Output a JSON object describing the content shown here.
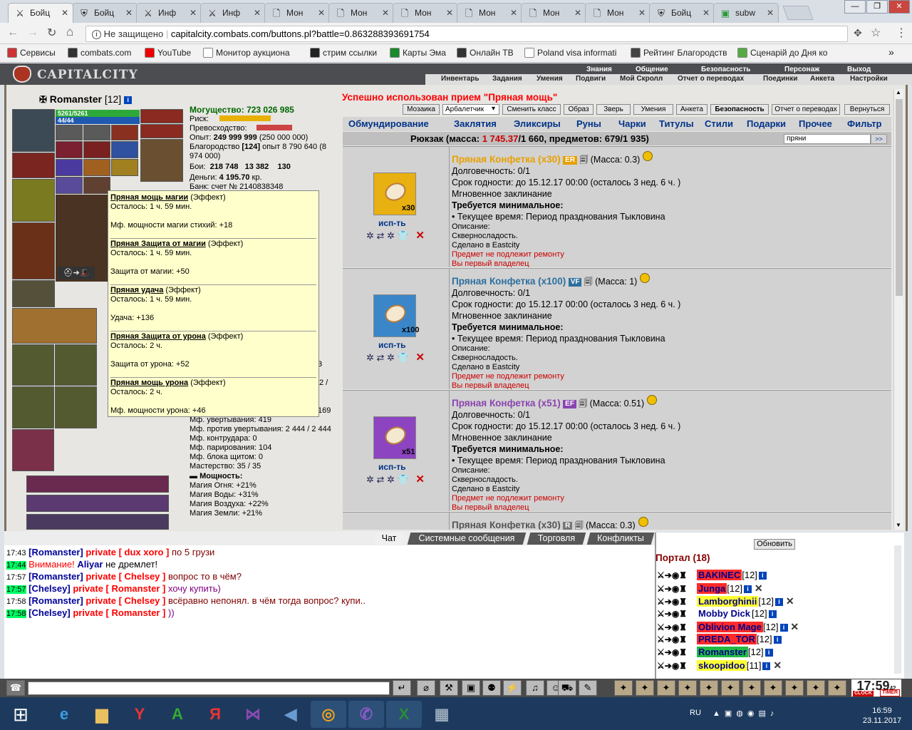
{
  "tabs": [
    {
      "label": "Бойц",
      "icon": "crossed-swords-icon",
      "active": true
    },
    {
      "label": "Бойц",
      "icon": "shield-icon",
      "active": false
    },
    {
      "label": "Инф",
      "icon": "crossed-swords-icon",
      "active": false
    },
    {
      "label": "Инф",
      "icon": "crossed-swords-icon",
      "active": false
    },
    {
      "label": "Мон",
      "icon": "page-icon",
      "active": false
    },
    {
      "label": "Мон",
      "icon": "page-icon",
      "active": false
    },
    {
      "label": "Мон",
      "icon": "page-icon",
      "active": false
    },
    {
      "label": "Мон",
      "icon": "page-icon",
      "active": false
    },
    {
      "label": "Мон",
      "icon": "page-icon",
      "active": false
    },
    {
      "label": "Мон",
      "icon": "page-icon",
      "active": false
    },
    {
      "label": "Бойц",
      "icon": "shield-icon",
      "active": false
    },
    {
      "label": "subw",
      "icon": "green-square-icon",
      "active": false
    }
  ],
  "address": {
    "security": "Не защищено",
    "url": "capitalcity.combats.com/buttons.pl?battle=0.863288393691754"
  },
  "bookmarks": [
    "Сервисы",
    "combats.com",
    "YouTube",
    "Монитор аукциона",
    "стрим ссылки",
    "Карты Эма",
    "Онлайн ТВ",
    "Poland visa informati",
    "Рейтинг Благородств",
    "Сценарій до Дня ко"
  ],
  "header": {
    "logo": "CAPITALCITY",
    "menu1": [
      "Знания",
      "Общение",
      "Безопасность",
      "Персонаж",
      "Выход"
    ],
    "menu2": [
      "Инвентарь",
      "Задания",
      "Умения",
      "Подвиги",
      "Мой Скролл",
      "Отчет о переводах",
      "Поединки",
      "Анкета",
      "Настройки"
    ]
  },
  "character": {
    "name": "Romanster",
    "level": "[12]",
    "hp": "5261/5261",
    "mana": "44/44"
  },
  "stats": {
    "power_label": "Могущество:",
    "power_value": "723 026 985",
    "risk_label": "Риск:",
    "superiority_label": "Превосходство:",
    "exp_label": "Опыт:",
    "exp_value": "249 999 999",
    "exp_extra": "(250 000 000)",
    "nobility_label": "Благородство",
    "nobility_value": "[124]",
    "nobility_exp": "опыт 8 790 640 (8 974 000)",
    "fights_label": "Бои:",
    "fights_win": "218 748",
    "fights_lose": "13 382",
    "fights_draw": "130",
    "money_label": "Деньги:",
    "money_value": "4 195.70",
    "money_unit": "кр.",
    "bank_label": "Банк: счет №",
    "bank_value": "2140838348"
  },
  "lower_stats": {
    "dodge": "Мф. увертывания: 419",
    "antidodge": "Мф. против увертывания: 2 444 / 2 444",
    "counter": "Мф. контрудара: 0",
    "parry": "Мф. парирования: 104",
    "block": "Мф. блока щитом: 0",
    "mastery": "Мастерство: 35 / 35",
    "power_header": "Мощность:",
    "fire": "Магия Огня: +21%",
    "water": "Магия Воды: +31%",
    "air": "Магия Воздуха: +22%",
    "earth": "Магия Земли: +21%",
    "partial1": "3",
    "partial2": "2 /",
    "partial3": "169"
  },
  "tooltip": [
    {
      "name": "Пряная мощь магии",
      "kind": "(Эффект)",
      "left": "Осталось: 1 ч. 59 мин.",
      "bonus": "Мф. мощности магии стихий: +18"
    },
    {
      "name": "Пряная Защита от магии",
      "kind": "(Эффект)",
      "left": "Осталось: 1 ч. 59 мин.",
      "bonus": "Защита от магии: +50"
    },
    {
      "name": "Пряная удача",
      "kind": "(Эффект)",
      "left": "Осталось: 1 ч. 59 мин.",
      "bonus": "Удача: +136"
    },
    {
      "name": "Пряная Защита от урона",
      "kind": "(Эффект)",
      "left": "Осталось: 2 ч.",
      "bonus": "Защита от урона: +52"
    },
    {
      "name": "Пряная мощь урона",
      "kind": "(Эффект)",
      "left": "Осталось: 2 ч.",
      "bonus": "Мф. мощности урона: +46"
    }
  ],
  "success_message": "Успешно использован прием \"Пряная мощь\"",
  "sub_buttons": [
    "Мозаика",
    "Арбалетчик",
    "Сменить класс",
    "Образ",
    "Зверь",
    "Умения",
    "Анкета",
    "Безопасность",
    "Отчет о переводах",
    "Вернуться"
  ],
  "inv_tabs": [
    "Обмундирование",
    "Заклятия",
    "Эликсиры",
    "Руны",
    "Чарки",
    "Титулы",
    "Стили",
    "Подарки",
    "Прочее",
    "Фильтр"
  ],
  "backpack": {
    "prefix": "Рюкзак (масса: ",
    "mass": "1 745.37",
    "suffix": "/1 660, предметов: 679/1 935)"
  },
  "search": {
    "value": "пряни",
    "go": ">>"
  },
  "items": [
    {
      "name": "Пряная Конфетка (x30)",
      "tag": "ER",
      "mass": "(Масса: 0.3)",
      "count": "x30",
      "color": "#e8a000",
      "tagcolor": "#e8a000",
      "bg": "#e8b010"
    },
    {
      "name": "Пряная Конфетка (x100)",
      "tag": "VF",
      "mass": "(Масса: 1)",
      "count": "x100",
      "color": "#2d6f9e",
      "tagcolor": "#2d6f9e",
      "bg": "#3a86c8"
    },
    {
      "name": "Пряная Конфетка (x51)",
      "tag": "EF",
      "mass": "(Масса: 0.51)",
      "count": "x51",
      "color": "#8a44b0",
      "tagcolor": "#8a44b0",
      "bg": "#8d44c0"
    },
    {
      "name": "Пряная Конфетка (x30)",
      "tag": "R",
      "mass": "(Масса: 0.3)",
      "count": "",
      "color": "#555555",
      "tagcolor": "#777777",
      "bg": "#999999"
    }
  ],
  "item_common": {
    "durability": "Долговечность: 0/1",
    "expiry": "Срок годности: до 15.12.17 00:00 (осталось 3 нед. 6 ч. )",
    "type": "Мгновенное заклинание",
    "req": "Требуется минимальное:",
    "req_item": "• Текущее время: Период празднования Тыкловина",
    "desc": "Описание:",
    "desc_text": "Скверносладость.",
    "made": "Сделано в Eastcity",
    "norepair": "Предмет не подлежит ремонту",
    "owner": "Вы первый владелец",
    "use": "исп-ть"
  },
  "chat_tabs": [
    "Чат",
    "Системные сообщения",
    "Торговля",
    "Конфликты"
  ],
  "chat": [
    {
      "time": "17:43",
      "green": false,
      "name": "[Romanster]",
      "priv": "private [ dux xoro ]",
      "text": "по 5 грузи"
    },
    {
      "time": "17:44",
      "green": true,
      "name": "",
      "priv": "",
      "warn": "Внимание!",
      "name2": "Aliyar",
      "text": "не дремлет!"
    },
    {
      "time": "17:57",
      "green": false,
      "name": "[Romanster]",
      "priv": "private [ Chelsey ]",
      "text": "вопрос то в чём?"
    },
    {
      "time": "17:57",
      "green": true,
      "name": "[Chelsey]",
      "priv": "private [ Romanster ]",
      "text": "хочу купить)"
    },
    {
      "time": "17:58",
      "green": false,
      "name": "[Romanster]",
      "priv": "private [ Chelsey ]",
      "text": "всёравно непонял. в чём тогда вопрос? купи.."
    },
    {
      "time": "17:58",
      "green": true,
      "name": "[Chelsey]",
      "priv": "private [ Romanster ]",
      "text": "))"
    }
  ],
  "online": {
    "refresh": "Обновить",
    "title": "Портал (18)",
    "users": [
      {
        "name": "BAKINEC",
        "lvl": "[12]",
        "hl": "#ff2a2a",
        "fg": "#000088"
      },
      {
        "name": "Junga",
        "lvl": "[12]",
        "hl": "#ff2a2a",
        "fg": "#000088"
      },
      {
        "name": "Lamborghinii",
        "lvl": "[12]",
        "hl": "#ffff33",
        "fg": "#000088"
      },
      {
        "name": "Mobby Dick",
        "lvl": "[12]",
        "hl": "",
        "fg": "#000088"
      },
      {
        "name": "Oblivion Mage",
        "lvl": "[12]",
        "hl": "#ff2a2a",
        "fg": "#000088"
      },
      {
        "name": "PREDA_TOR",
        "lvl": "[12]",
        "hl": "#ff2a2a",
        "fg": "#000088"
      },
      {
        "name": "Romanster",
        "lvl": "[12]",
        "hl": "#22bb44",
        "fg": "#000088"
      },
      {
        "name": "skoopidoo",
        "lvl": "[11]",
        "hl": "#ffff33",
        "fg": "#000088"
      }
    ]
  },
  "clock": {
    "time": "17:59",
    "sec": "42",
    "label1": "CLOCK",
    "label2": "TIMER"
  },
  "tray": {
    "lang": "RU",
    "time": "16:59",
    "date": "23.11.2017"
  }
}
